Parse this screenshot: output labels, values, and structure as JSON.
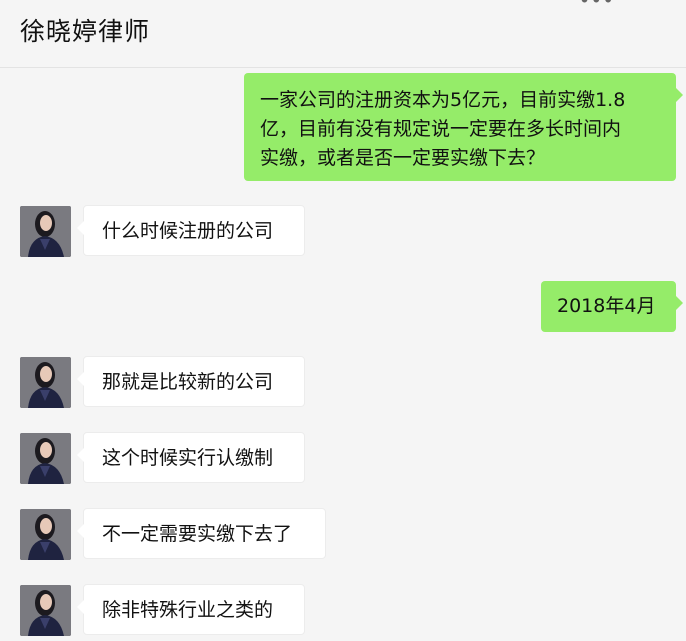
{
  "header": {
    "title": "徐晓婷律师",
    "more_icon": "more-icon"
  },
  "colors": {
    "outgoing_bubble": "#95ec69",
    "incoming_bubble": "#ffffff",
    "background": "#f5f5f5"
  },
  "messages": [
    {
      "direction": "out",
      "lines": [
        "一家公司的注册资本为5亿元，目前实缴1.8",
        "亿，目前有没有规定说一定要在多长时间内",
        "实缴，或者是否一定要实缴下去？"
      ]
    },
    {
      "direction": "in",
      "text": "什么时候注册的公司"
    },
    {
      "direction": "out",
      "text": "2018年4月"
    },
    {
      "direction": "in",
      "text": "那就是比较新的公司"
    },
    {
      "direction": "in",
      "text": "这个时候实行认缴制"
    },
    {
      "direction": "in",
      "text": "不一定需要实缴下去了"
    },
    {
      "direction": "in",
      "text": "除非特殊行业之类的"
    }
  ]
}
